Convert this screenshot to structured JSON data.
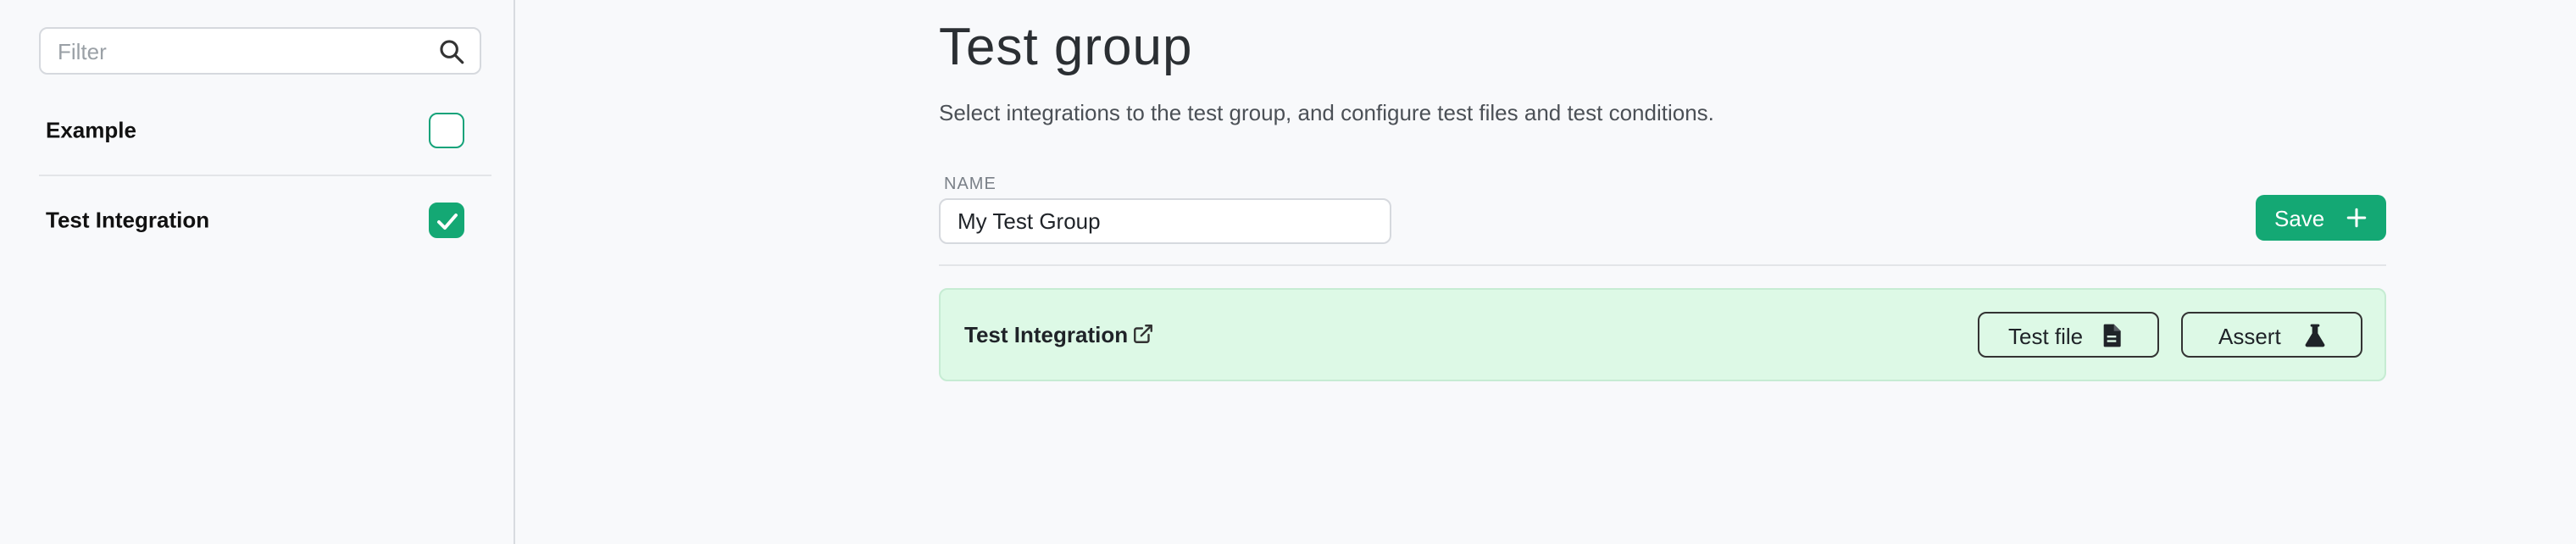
{
  "sidebar": {
    "filter": {
      "placeholder": "Filter",
      "value": ""
    },
    "items": [
      {
        "label": "Example",
        "checked": false
      },
      {
        "label": "Test Integration",
        "checked": true
      }
    ]
  },
  "main": {
    "title": "Test group",
    "subtitle": "Select integrations to the test group, and configure test files and test conditions.",
    "name_label": "NAME",
    "name_value": "My Test Group",
    "save_label": "Save",
    "integration": {
      "name": "Test Integration",
      "test_file_label": "Test file",
      "assert_label": "Assert"
    }
  },
  "colors": {
    "accent": "#14a874",
    "row_background": "#ddf9e6",
    "page_background": "#f8f9fb"
  },
  "icons": [
    "search-icon",
    "check-icon",
    "plus-icon",
    "external-link-icon",
    "file-icon",
    "flask-icon"
  ]
}
